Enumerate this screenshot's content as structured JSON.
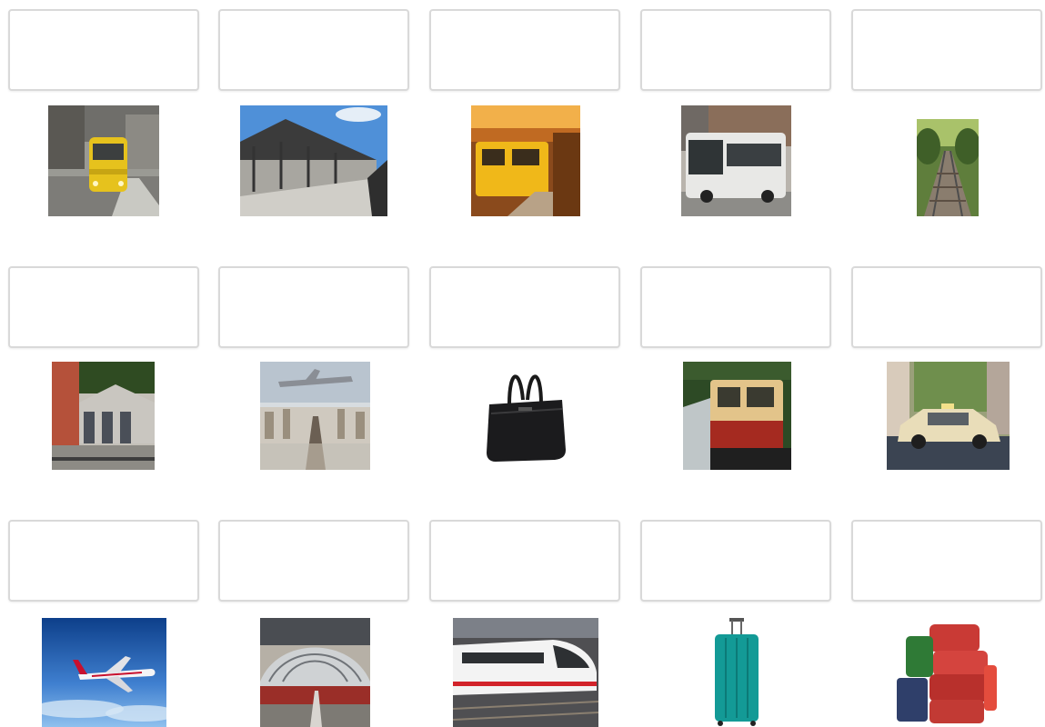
{
  "worksheet": {
    "answer_fields": [
      {
        "value": "",
        "placeholder": ""
      },
      {
        "value": "",
        "placeholder": ""
      },
      {
        "value": "",
        "placeholder": ""
      },
      {
        "value": "",
        "placeholder": ""
      },
      {
        "value": "",
        "placeholder": ""
      },
      {
        "value": "",
        "placeholder": ""
      },
      {
        "value": "",
        "placeholder": ""
      },
      {
        "value": "",
        "placeholder": ""
      },
      {
        "value": "",
        "placeholder": ""
      },
      {
        "value": "",
        "placeholder": ""
      },
      {
        "value": "",
        "placeholder": ""
      },
      {
        "value": "",
        "placeholder": ""
      },
      {
        "value": "",
        "placeholder": ""
      },
      {
        "value": "",
        "placeholder": ""
      },
      {
        "value": "",
        "placeholder": ""
      }
    ],
    "pictures": [
      "tram-photo",
      "train-platform-photo",
      "subway-train-photo",
      "bus-photo",
      "railway-tracks-photo",
      "station-building-photo",
      "airport-runway-photo",
      "travel-bag-photo",
      "s-bahn-train-photo",
      "taxi-photo",
      "airplane-photo",
      "train-station-hall-photo",
      "ice-train-photo",
      "suitcase-photo",
      "luggage-pile-photo"
    ]
  }
}
